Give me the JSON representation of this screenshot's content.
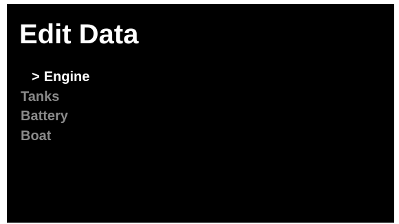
{
  "screen": {
    "title": "Edit Data",
    "colors": {
      "background": "#000000",
      "title": "#ffffff",
      "selected_item": "#ffffff",
      "unselected_item": "#8a8a8a"
    }
  },
  "menu": {
    "cursor": ">",
    "selected_index": 0,
    "items": [
      {
        "label": "Engine"
      },
      {
        "label": "Tanks"
      },
      {
        "label": "Battery"
      },
      {
        "label": "Boat"
      }
    ]
  }
}
